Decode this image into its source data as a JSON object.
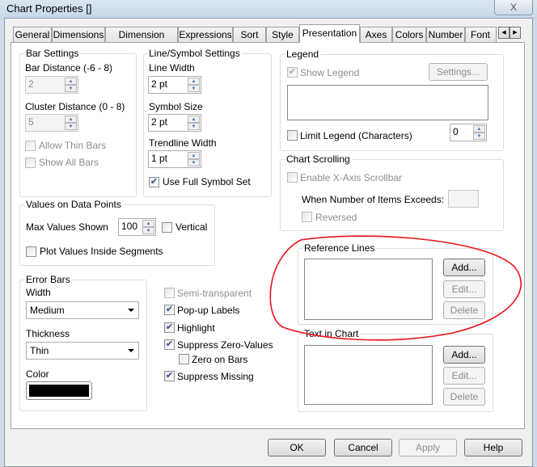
{
  "window": {
    "title": "Chart Properties []",
    "close": "X"
  },
  "tabs": [
    "General",
    "Dimensions",
    "Dimension Limits",
    "Expressions",
    "Sort",
    "Style",
    "Presentation",
    "Axes",
    "Colors",
    "Number",
    "Font"
  ],
  "active_tab": "Presentation",
  "bar_settings": {
    "title": "Bar Settings",
    "bar_distance_label": "Bar Distance (-6 - 8)",
    "bar_distance": "2",
    "cluster_distance_label": "Cluster Distance (0 - 8)",
    "cluster_distance": "5",
    "allow_thin_bars": "Allow Thin Bars",
    "show_all_bars": "Show All Bars"
  },
  "line_symbol": {
    "title": "Line/Symbol Settings",
    "line_width_label": "Line Width",
    "line_width": "2 pt",
    "symbol_size_label": "Symbol Size",
    "symbol_size": "2 pt",
    "trendline_width_label": "Trendline Width",
    "trendline_width": "1 pt",
    "use_full_symbol_set": "Use Full Symbol Set"
  },
  "values_on_data_points": {
    "title": "Values on Data Points",
    "max_values_label": "Max Values Shown",
    "max_values": "100",
    "vertical": "Vertical",
    "plot_inside": "Plot Values Inside Segments"
  },
  "error_bars": {
    "title": "Error Bars",
    "width_label": "Width",
    "width": "Medium",
    "thickness_label": "Thickness",
    "thickness": "Thin",
    "color_label": "Color",
    "color": "#000000"
  },
  "options": {
    "semi_transparent": "Semi-transparent",
    "popup_labels": "Pop-up Labels",
    "highlight": "Highlight",
    "suppress_zero": "Suppress Zero-Values",
    "zero_on_bars": "Zero on Bars",
    "suppress_missing": "Suppress Missing"
  },
  "legend": {
    "title": "Legend",
    "show_legend": "Show Legend",
    "settings": "Settings...",
    "limit_legend": "Limit Legend (Characters)",
    "limit_value": "0"
  },
  "chart_scrolling": {
    "title": "Chart Scrolling",
    "enable_scrollbar": "Enable X-Axis Scrollbar",
    "when_exceeds": "When Number of Items Exceeds:",
    "reversed": "Reversed"
  },
  "reference_lines": {
    "title": "Reference Lines",
    "add": "Add...",
    "edit": "Edit...",
    "delete": "Delete"
  },
  "text_in_chart": {
    "title": "Text in Chart",
    "add": "Add...",
    "edit": "Edit...",
    "delete": "Delete"
  },
  "footer": {
    "ok": "OK",
    "cancel": "Cancel",
    "apply": "Apply",
    "help": "Help"
  },
  "annotation_color": "#e8141a"
}
